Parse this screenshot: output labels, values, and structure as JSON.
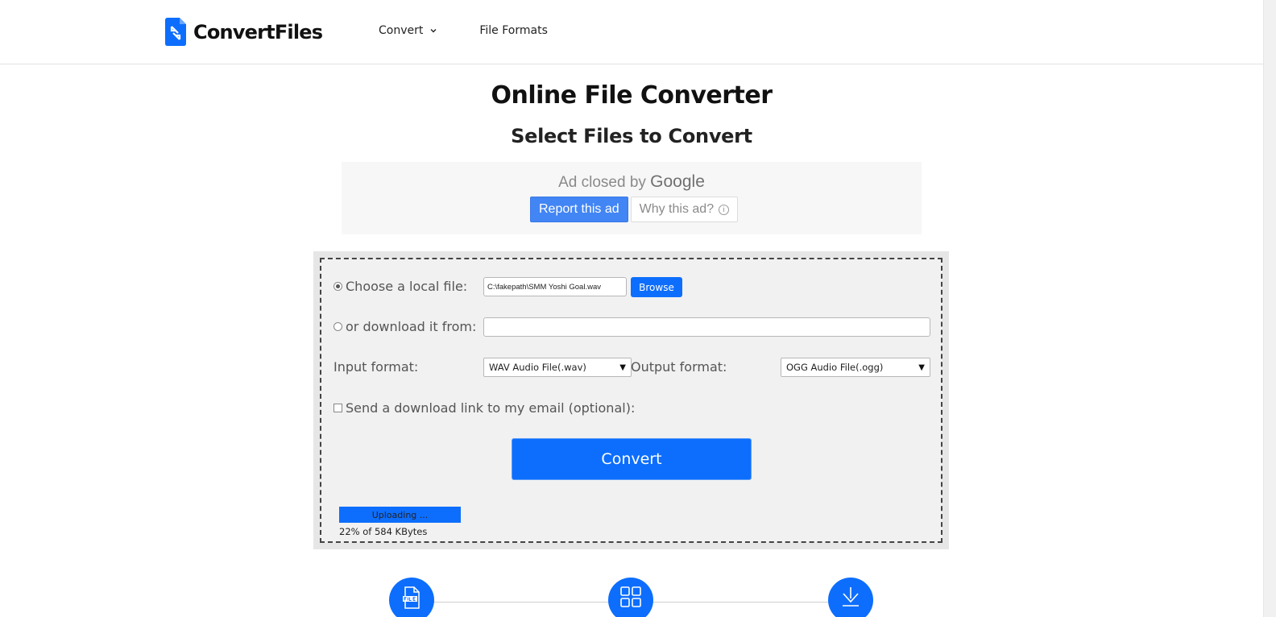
{
  "header": {
    "logo_text": "ConvertFiles",
    "nav": {
      "convert_label": "Convert",
      "file_formats_label": "File Formats"
    }
  },
  "main": {
    "title": "Online File Converter",
    "subtitle": "Select Files to Convert"
  },
  "ad": {
    "closed_by": "Ad closed by",
    "brand": "Google",
    "report_label": "Report this ad",
    "why_label": "Why this ad?",
    "info_glyph": "i"
  },
  "form": {
    "local_file_label": "Choose a local file:",
    "local_file_value": "C:\\fakepath\\SMM Yoshi Goal.wav",
    "local_file_selected": true,
    "browse_label": "Browse",
    "download_label": "or download it from:",
    "download_value": "",
    "input_format_label": "Input format:",
    "input_format_value": "WAV Audio File(.wav)",
    "output_format_label": "Output format:",
    "output_format_value": "OGG Audio File(.ogg)",
    "select_arrow": "▼",
    "email_label": "Send a download link to my email (optional):",
    "email_checked": false,
    "convert_label": "Convert"
  },
  "upload": {
    "status": "Uploading ...",
    "progress_text": "22% of 584 KBytes"
  },
  "colors": {
    "accent": "#0d6efd",
    "ad_report": "#4285f4"
  },
  "icons": {
    "logo": "convertfiles-logo-icon",
    "nav_chevron": "chevron-down-icon",
    "step1": "file-icon",
    "step2": "grid-icon",
    "step3": "download-icon"
  }
}
